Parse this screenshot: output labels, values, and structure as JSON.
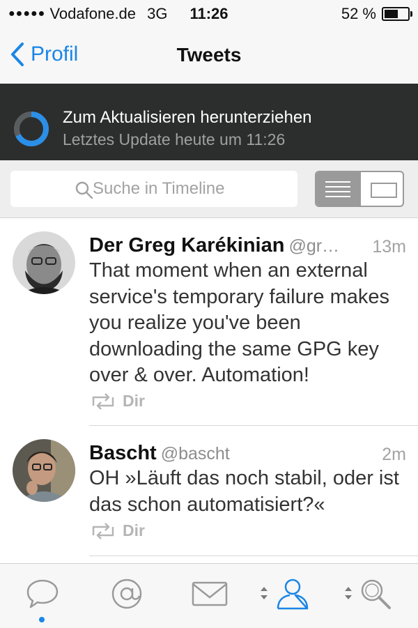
{
  "status_bar": {
    "signal": "●●●●●",
    "carrier": "Vodafone.de",
    "network": "3G",
    "time": "11:26",
    "battery_text": "52 %",
    "battery_level": 0.52
  },
  "nav": {
    "back_label": "Profil",
    "title": "Tweets"
  },
  "refresh": {
    "title": "Zum Aktualisieren herunterziehen",
    "subtitle": "Letztes Update heute um 11:26"
  },
  "search": {
    "placeholder": "Suche in Timeline"
  },
  "tweets": [
    {
      "name": "Der Greg Karékinian",
      "handle": "@gr…",
      "ago": "13m",
      "text": "That moment when an external service's temporary failure makes you realize you've been downloading the same GPG key over & over. Automation!",
      "meta": "Dir"
    },
    {
      "name": "Bascht",
      "handle": "@bascht",
      "ago": "2m",
      "text": "OH »Läuft das noch stabil, oder ist das schon automatisiert?«",
      "meta": "Dir"
    }
  ],
  "tabs": [
    "chat-bubble-icon",
    "at-sign-icon",
    "envelope-icon",
    "person-icon",
    "magnifier-icon"
  ],
  "colors": {
    "accent": "#1a86e6",
    "banner": "#2c2d2d"
  }
}
